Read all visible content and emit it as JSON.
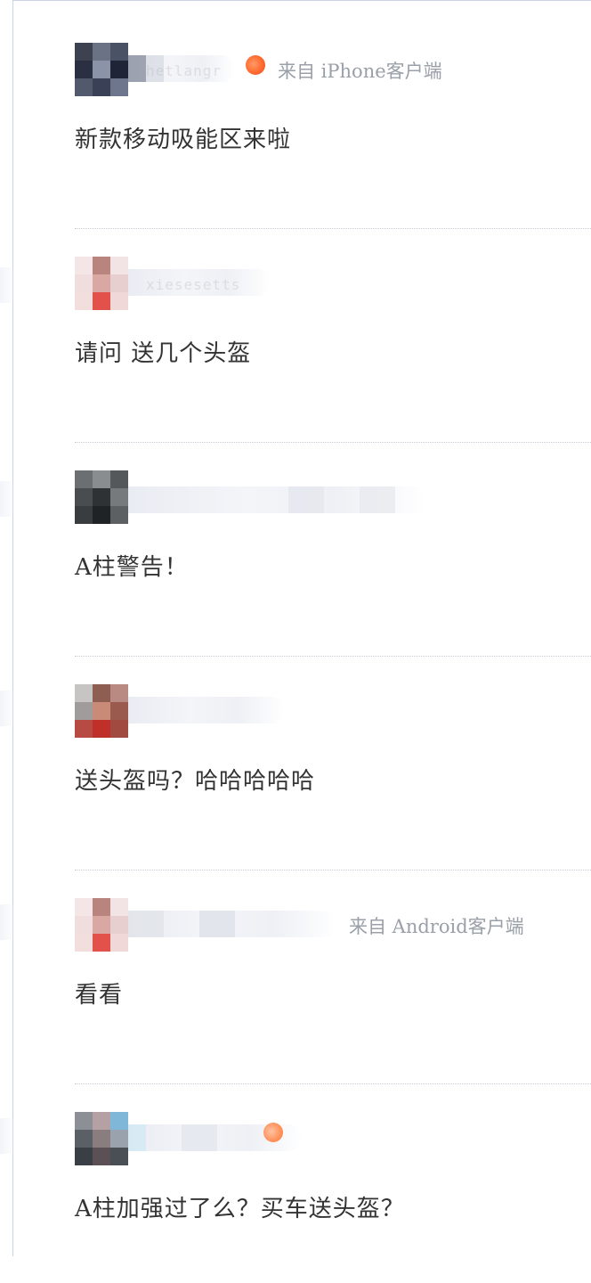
{
  "comments": [
    {
      "username": "hetlangr",
      "source": "来自 iPhone客户端",
      "text": "新款移动吸能区来啦",
      "has_badge": true,
      "avatar_colors": [
        "#3c4250",
        "#6a7284",
        "#4a5266",
        "#2a3042",
        "#8a93a8",
        "#1f2536",
        "#52596c",
        "#3a4156",
        "#6d768c"
      ]
    },
    {
      "username": "xiesesetts",
      "source": "",
      "text": "请问 送几个头盔",
      "has_badge": false,
      "avatar_colors": [
        "#f4e6e6",
        "#b9847e",
        "#f2e4e4",
        "#f0dede",
        "#d9a8a2",
        "#e8cfcf",
        "#f3dede",
        "#e2524a",
        "#f0d8d8"
      ]
    },
    {
      "username": "",
      "source": "",
      "text": "A柱警告！",
      "has_badge": false,
      "avatar_colors": [
        "#6c6f72",
        "#8a8d8f",
        "#54585b",
        "#4a4d50",
        "#2f3235",
        "#777a7d",
        "#3a3d40",
        "#202326",
        "#5d6063"
      ]
    },
    {
      "username": "",
      "source": "",
      "text": "送头盔吗？哈哈哈哈哈",
      "has_badge": false,
      "avatar_colors": [
        "#c7c4c4",
        "#8e5e52",
        "#b88a82",
        "#a09c9c",
        "#c98a78",
        "#9a5a4e",
        "#b84a44",
        "#c0302a",
        "#a04a40"
      ]
    },
    {
      "username": "",
      "source": "来自 Android客户端",
      "text": "看看",
      "has_badge": false,
      "avatar_colors": [
        "#f4e6e6",
        "#b9847e",
        "#f2e4e4",
        "#f0dede",
        "#d9a8a2",
        "#e8cfcf",
        "#f3dede",
        "#e2524a",
        "#f0d8d8"
      ]
    },
    {
      "username": "",
      "source": "",
      "text": "A柱加强过了么？买车送头盔？",
      "has_badge": true,
      "avatar_colors": [
        "#8c8f95",
        "#b5a0a4",
        "#7fb7d8",
        "#5b5f66",
        "#8a7d80",
        "#9aa3ad",
        "#3a3e45",
        "#5a5055",
        "#4a4f56"
      ]
    }
  ]
}
